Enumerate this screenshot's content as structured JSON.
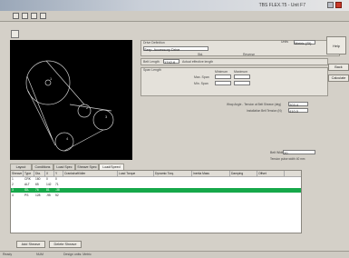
{
  "window": {
    "title": "TBS FLEX.T5 - Unit F7"
  },
  "toolbar": {
    "icons": [
      "new-icon",
      "open-icon",
      "save-icon",
      "print-icon"
    ]
  },
  "drive_def": {
    "header": "Drive Definition",
    "type_value": "Serp. Accessory Drive",
    "units_label": "Units",
    "units_value": "Metric (SI)",
    "opt_label": "Std.",
    "check_label": "Reverse"
  },
  "belt_lengths": {
    "label": "Belt Length",
    "value": "1742.6",
    "note": "Actual effective length"
  },
  "span_length": {
    "header": "Span Length",
    "col1": "Minimum",
    "col2": "Maximum",
    "row1": "Max. Span",
    "row2": "Min. Span"
  },
  "right_buttons": {
    "help_label": "Help",
    "back_label": "Back",
    "calc_label": "Calculate"
  },
  "side_fields": {
    "row1_label": "Wrap Angle - Tension at Belt Sheave (deg)",
    "row1_value": "203.4",
    "row2_label": "Installation Belt Tension (N)",
    "row2_value": "410.0"
  },
  "lower_right": {
    "label": "Belt Width",
    "value": "20",
    "note": "Tension pulse width 40 mm"
  },
  "tabs": [
    "Layout",
    "Conditions",
    "Load Spec",
    "Sheave Spec",
    "Load/Speed"
  ],
  "grid": {
    "headers": [
      "Sheave",
      "Type",
      "Dia.",
      "X",
      "Y",
      "Crankshaft/Idler",
      "Load Torque",
      "Dynamic Torq.",
      "Inertia Mass",
      "Damping",
      "Offset"
    ],
    "rows": [
      [
        "1",
        "CRK",
        "160",
        "0",
        "0",
        "",
        "",
        "",
        "",
        "",
        ""
      ],
      [
        "2",
        "ALT",
        "65",
        "142",
        "71",
        "",
        "",
        "",
        "",
        "",
        ""
      ],
      [
        "3",
        "IDL",
        "76",
        "81",
        "-38",
        "",
        "",
        "",
        "",
        "",
        ""
      ],
      [
        "4",
        "PS",
        "128",
        "-95",
        "52",
        "",
        "",
        "",
        "",
        "",
        ""
      ]
    ],
    "selected_row": 2
  },
  "bottom_buttons": {
    "b1": "Add Sheave",
    "b2": "Delete Sheave"
  },
  "status": {
    "left": "Ready",
    "mid": "NUM",
    "right": "Design units: Metric"
  }
}
